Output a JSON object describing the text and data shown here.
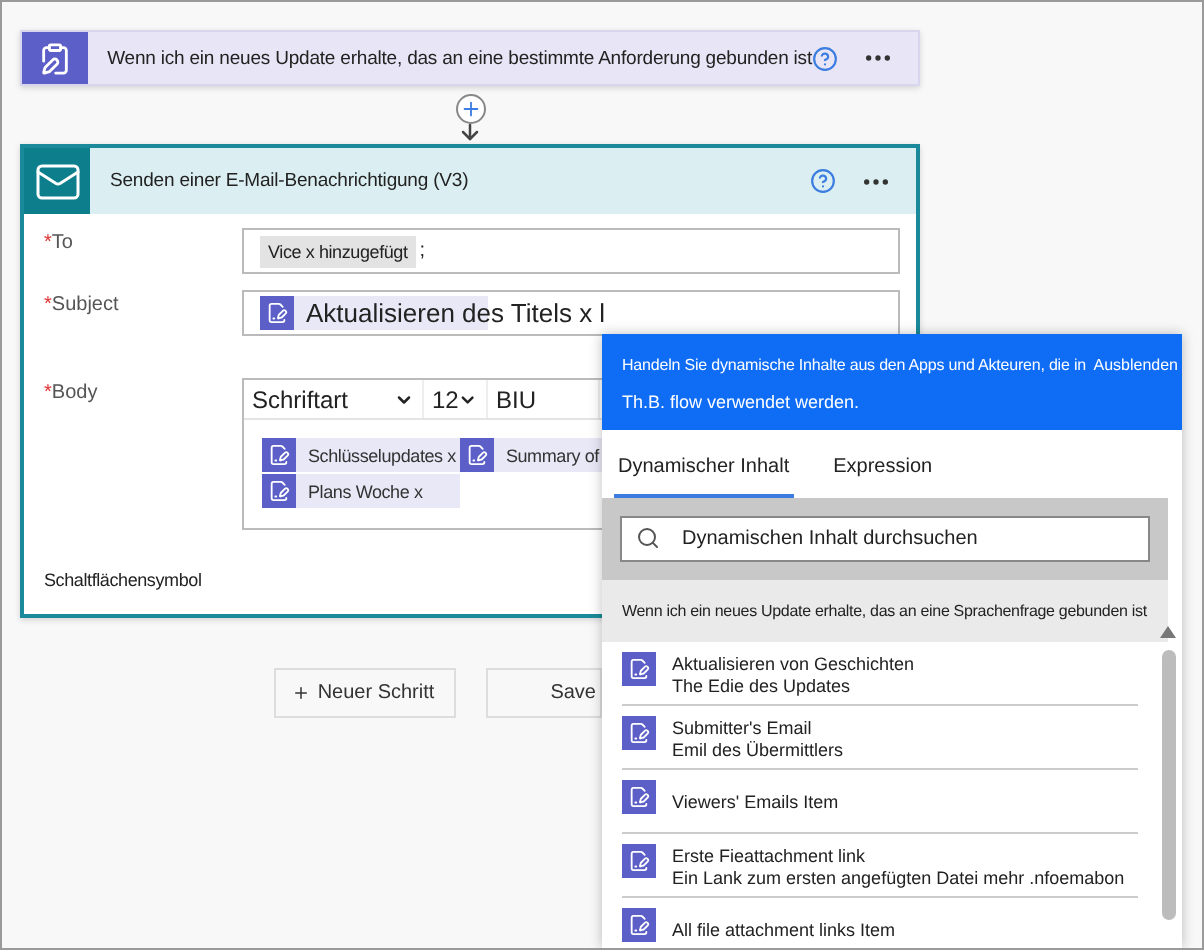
{
  "trigger": {
    "title": "Wenn ich ein neues Update erhalte, das  an eine bestimmte Anforderung gebunden ist"
  },
  "action": {
    "title": "Senden einer E-Mail-Benachrichtigung (V3)",
    "fields": [
      {
        "kind": "recipients",
        "label": "To",
        "required_mark": "*",
        "token": "Vice x hinzugefügt",
        "suffix": ";"
      },
      {
        "kind": "token",
        "label": "Subject",
        "required_mark": "*",
        "token": "Aktualisieren des Titels x l"
      },
      {
        "kind": "editor",
        "label": "Body",
        "required_mark": "*",
        "font": "Schriftart",
        "size": "12",
        "styles": "BIU",
        "tokens": [
          "Schlüsselupdates x",
          "Summary of",
          "Plans Woche x"
        ]
      }
    ],
    "advanced": "Schaltflächensymbol"
  },
  "buttons": [
    {
      "kind": "add",
      "label": "Neuer Schritt"
    },
    {
      "kind": "save",
      "label": "Save"
    }
  ],
  "panel": {
    "info": "Handeln Sie dynamische Inhalte aus den Apps und Akteuren, die in",
    "info_2": "Th.B. flow verwendet werden.",
    "hide": "Ausblenden",
    "tabs": [
      {
        "label": "Dynamischer Inhalt",
        "selected": true
      },
      {
        "label": "Expression",
        "selected": false
      }
    ],
    "search": {
      "placeholder": "Dynamischen Inhalt durchsuchen"
    },
    "group": "Wenn ich ein neues Update erhalte, das an eine Sprachenfrage gebunden ist",
    "items": [
      {
        "title": "Aktualisieren  von Geschichten",
        "subtitle": "The Edie des Updates"
      },
      {
        "title": "Submitter's Email",
        "subtitle": "Emil des Übermittlers"
      },
      {
        "title": "Viewers' Emails Item"
      },
      {
        "title": "Erste Fieattachment link",
        "subtitle": "Ein Lank zum ersten angefügten Datei mehr .nfoemabon"
      },
      {
        "title": "All file attachment links Item"
      }
    ]
  }
}
